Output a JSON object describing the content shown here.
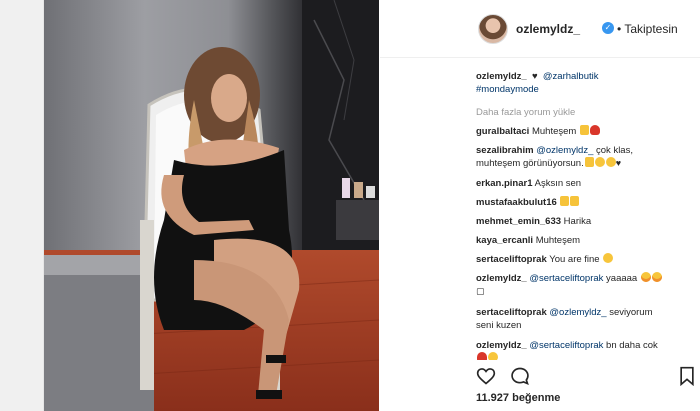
{
  "post": {
    "username": "ozlemyldz_",
    "follow_status": "• Takiptesin",
    "caption_user": "ozlemyldz_",
    "caption_mention": "@zarhalbutik",
    "caption_tag": "#mondaymode",
    "load_more": "Daha fazla yorum yükle",
    "likes": "11.927 beğenme"
  },
  "comments": [
    {
      "user": "guralbaltaci",
      "text": "Muhteşem"
    },
    {
      "user": "sezalibrahim",
      "mention": "@ozlemyldz_",
      "text": "çok klas,",
      "text2": "muhteşem görünüyorsun."
    },
    {
      "user": "erkan.pinar1",
      "text": "Aşksın sen"
    },
    {
      "user": "mustafaakbulut16",
      "text": ""
    },
    {
      "user": "mehmet_emin_633",
      "text": "Harika"
    },
    {
      "user": "kaya_ercanli",
      "text": "Muhteşem"
    },
    {
      "user": "sertaceliftoprak",
      "text": "You are fine"
    },
    {
      "user": "ozlemyldz_",
      "mention": "@sertaceliftoprak",
      "text": "yaaaaa"
    },
    {
      "user": "sertaceliftoprak",
      "mention": "@ozlemyldz_",
      "text": "seviyorum",
      "text2": "seni kuzen"
    },
    {
      "user": "ozlemyldz_",
      "mention": "@sertaceliftoprak",
      "text": "bn daha cok"
    }
  ],
  "icons": {
    "verified": "verified-badge-icon",
    "like": "heart-outline-icon",
    "comment": "speech-bubble-icon",
    "save": "bookmark-icon",
    "broken_emoji": "missing-glyph-icon"
  },
  "colors": {
    "mention": "#003569",
    "verified": "#3897f0",
    "muted": "#999999"
  }
}
